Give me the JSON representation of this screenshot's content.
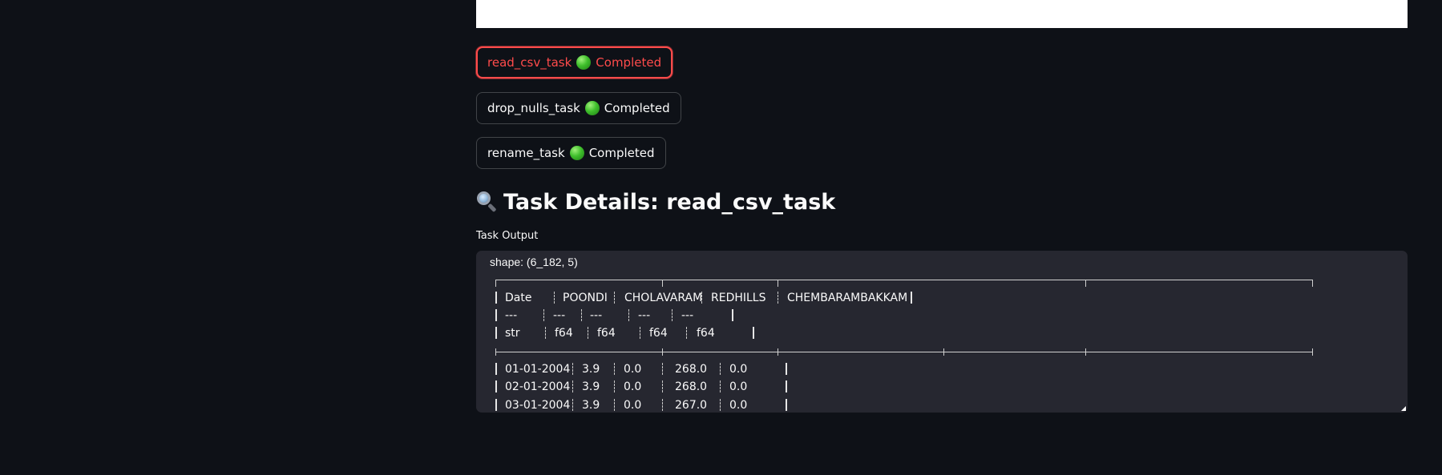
{
  "tasks": [
    {
      "name": "read_csv_task",
      "status_icon": "green-circle",
      "status": "Completed",
      "active": true
    },
    {
      "name": "drop_nulls_task",
      "status_icon": "green-circle",
      "status": "Completed",
      "active": false
    },
    {
      "name": "rename_task",
      "status_icon": "green-circle",
      "status": "Completed",
      "active": false
    }
  ],
  "details": {
    "title_icon": "magnifying-glass",
    "title": "Task Details: read_csv_task"
  },
  "output": {
    "label": "Task Output",
    "shape": "shape: (6_182, 5)",
    "columns": [
      "Date",
      "POONDI",
      "CHOLAVARAM",
      "REDHILLS",
      "CHEMBARAMBAKKAM"
    ],
    "separators": [
      "---",
      "---",
      "---",
      "---",
      "---"
    ],
    "dtypes": [
      "str",
      "f64",
      "f64",
      "f64",
      "f64"
    ],
    "rows": [
      [
        "01-01-2004",
        "3.9",
        "0.0",
        "268.0",
        "0.0"
      ],
      [
        "02-01-2004",
        "3.9",
        "0.0",
        "268.0",
        "0.0"
      ],
      [
        "03-01-2004",
        "3.9",
        "0.0",
        "267.0",
        "0.0"
      ]
    ]
  },
  "colors": {
    "background": "#0e1117",
    "code_background": "#262730",
    "accent": "#ff4b4b",
    "text": "#fafafa"
  }
}
